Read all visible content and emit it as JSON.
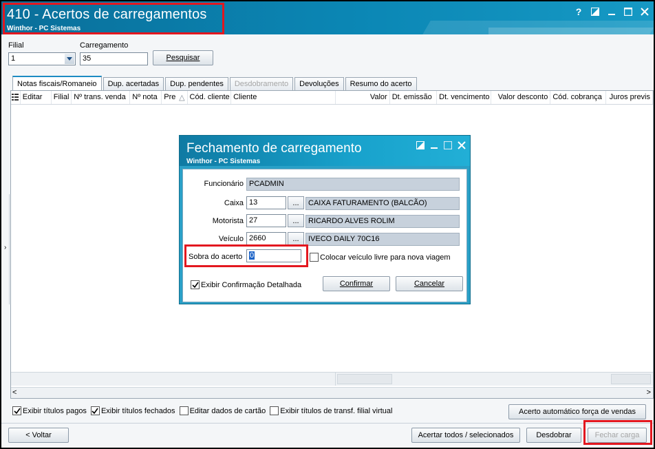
{
  "window": {
    "title": "410 - Acertos de carregamentos",
    "subtitle": "Winthor - PC Sistemas",
    "controls": [
      "?",
      "restore",
      "minimize",
      "maximize",
      "close"
    ]
  },
  "filters": {
    "filial_label": "Filial",
    "filial_value": "1",
    "carregamento_label": "Carregamento",
    "carregamento_value": "35",
    "search_button": "Pesquisar"
  },
  "tabs": [
    {
      "label": "Notas fiscais/Romaneio",
      "active": true
    },
    {
      "label": "Dup. acertadas"
    },
    {
      "label": "Dup. pendentes"
    },
    {
      "label": "Desdobramento",
      "disabled": true
    },
    {
      "label": "Devoluções"
    },
    {
      "label": "Resumo do acerto"
    }
  ],
  "grid": {
    "columns": [
      "Editar",
      "Filial",
      "Nº trans. venda",
      "Nº nota",
      "Pre",
      "Cód. cliente",
      "Cliente",
      "Valor",
      "Dt. emissão",
      "Dt. vencimento",
      "Valor desconto",
      "Cód. cobrança",
      "Juros previs"
    ]
  },
  "options": {
    "exibir_titulos_pagos": {
      "label": "Exibir títulos pagos",
      "checked": true
    },
    "exibir_titulos_fechados": {
      "label": "Exibir títulos fechados",
      "checked": true
    },
    "editar_dados_cartao": {
      "label": "Editar dados de cartão",
      "checked": false
    },
    "exibir_titulos_transf": {
      "label": "Exibir títulos de transf. filial virtual",
      "checked": false
    }
  },
  "actions": {
    "acerto_automatico": "Acerto automático força de vendas",
    "voltar": "< Voltar",
    "acertar_todos": "Acertar todos / selecionados",
    "desdobrar": "Desdobrar",
    "fechar_carga": "Fechar carga"
  },
  "dialog": {
    "title": "Fechamento de carregamento",
    "subtitle": "Winthor - PC Sistemas",
    "funcionario_label": "Funcionário",
    "funcionario_value": "PCADMIN",
    "caixa_label": "Caixa",
    "caixa_code": "13",
    "caixa_name": "CAIXA FATURAMENTO (BALCÃO)",
    "motorista_label": "Motorista",
    "motorista_code": "27",
    "motorista_name": "RICARDO ALVES ROLIM",
    "veiculo_label": "Veículo",
    "veiculo_code": "2660",
    "veiculo_name": "IVECO DAILY 70C16",
    "lookup_button": "...",
    "sobra_label": "Sobra do acerto",
    "sobra_value": "0",
    "veiculo_livre": {
      "label": "Colocar veículo livre para nova viagem",
      "checked": false
    },
    "exibir_confirmacao": {
      "label": "Exibir Confirmação Detalhada",
      "checked": true
    },
    "confirmar": "Confirmar",
    "cancelar": "Cancelar"
  },
  "colors": {
    "title_bar": "#0b87b5",
    "highlight": "#e3171f",
    "tab_accent": "#1c8bc3"
  }
}
